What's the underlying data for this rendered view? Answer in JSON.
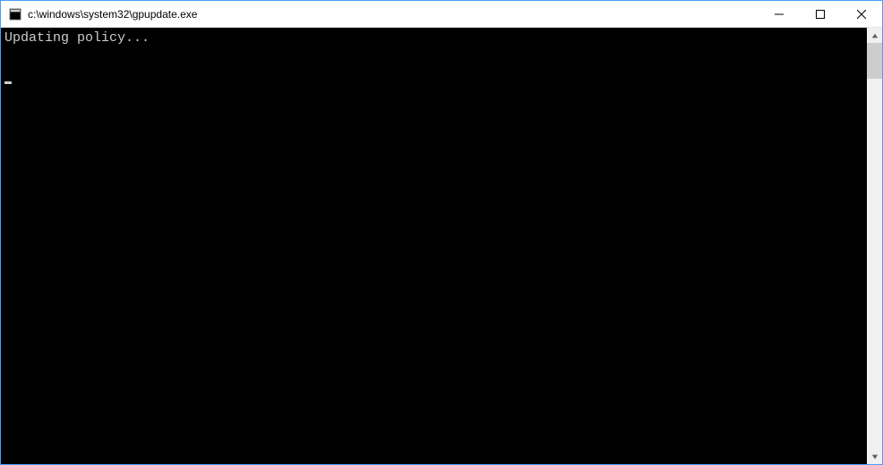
{
  "window": {
    "title": "c:\\windows\\system32\\gpupdate.exe"
  },
  "terminal": {
    "line1": "Updating policy..."
  }
}
